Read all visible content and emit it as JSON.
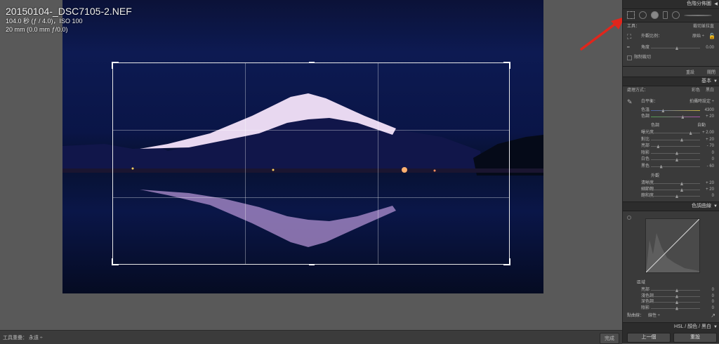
{
  "image_info": {
    "filename": "20150104-_DSC7105-2.NEF",
    "exposure": "104.0 秒 (ƒ / 4.0)，ISO 100",
    "lens": "20 mm (0.0 mm ƒ/0.0)"
  },
  "bottom_bar": {
    "tool_overlay_label": "工具重疊：",
    "tool_overlay_value": "永遠 ÷",
    "done_label": "完成"
  },
  "panel": {
    "histogram_header": "色階分佈圖",
    "crop": {
      "tool_label": "工具：",
      "tool_value": "裁切並拉直",
      "aspect_label": "外觀比例：",
      "aspect_value": "原始 ÷",
      "angle_label": "角度",
      "angle_value": "0.00",
      "constrain_label": "限制裁切",
      "reset_label": "重設",
      "close_label": "關閉"
    },
    "basic": {
      "header": "基本",
      "treatment_label": "處理方式：",
      "color_label": "彩色",
      "bw_label": "黑白",
      "wb_label": "白平衡：",
      "wb_value": "拍攝時設定 ÷",
      "temp_label": "色溫",
      "temp_value": "4300",
      "tint_label": "色調",
      "tint_value": "+ 20",
      "tone_label": "色調",
      "auto_label": "自動",
      "rows": [
        {
          "label": "曝光度",
          "value": "+ 2.00",
          "pos": 0.78
        },
        {
          "label": "對比",
          "value": "+ 20",
          "pos": 0.6
        },
        {
          "label": "亮部",
          "value": "- 70",
          "pos": 0.12
        },
        {
          "label": "陰影",
          "value": "0",
          "pos": 0.5
        },
        {
          "label": "白色",
          "value": "0",
          "pos": 0.5
        },
        {
          "label": "黑色",
          "value": "- 60",
          "pos": 0.18
        }
      ],
      "presence_label": "外觀",
      "presence_rows": [
        {
          "label": "清晰度",
          "value": "+ 20",
          "pos": 0.6
        },
        {
          "label": "細節飽",
          "value": "+ 20",
          "pos": 0.6
        },
        {
          "label": "飽和度",
          "value": "0",
          "pos": 0.5
        }
      ]
    },
    "tone_curve": {
      "header": "色調曲線",
      "region_label": "區域",
      "rows": [
        {
          "label": "亮部",
          "value": "0"
        },
        {
          "label": "淺色調",
          "value": "0"
        },
        {
          "label": "深色調",
          "value": "0"
        },
        {
          "label": "陰影",
          "value": "0"
        }
      ],
      "point_curve_label": "點曲線：",
      "point_curve_value": "線性 ÷"
    },
    "hsl": {
      "hsl_label": "HSL",
      "color_label": "顏色",
      "bw_label": "黑白"
    },
    "previous_label": "上一個",
    "reset_label": "重設"
  }
}
